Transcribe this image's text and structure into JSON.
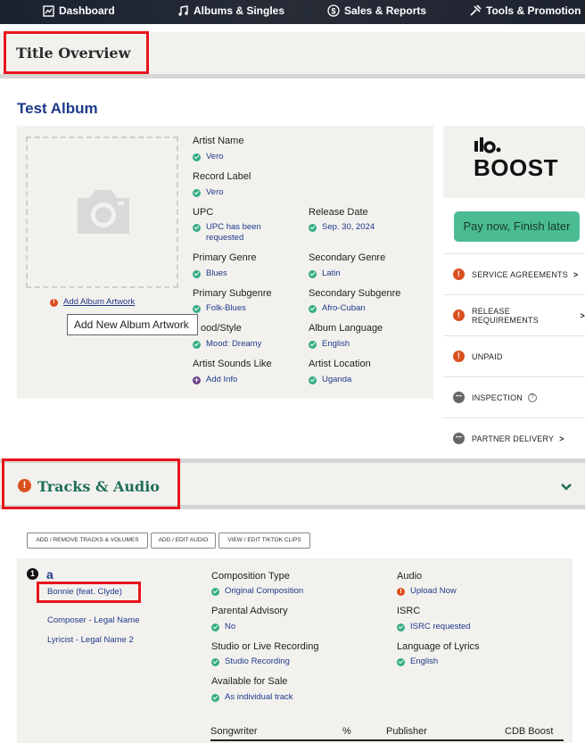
{
  "nav": {
    "items": [
      {
        "label": "Dashboard",
        "icon": "dashboard-icon"
      },
      {
        "label": "Albums & Singles",
        "icon": "music-note-icon"
      },
      {
        "label": "Sales & Reports",
        "icon": "dollar-icon"
      },
      {
        "label": "Tools & Promotion",
        "icon": "tools-icon"
      }
    ]
  },
  "page": {
    "title": "Title Overview"
  },
  "album": {
    "title": "Test Album",
    "add_artwork": "Add Album Artwork",
    "tooltip": "Add New Album Artwork",
    "fields": {
      "artist_name": {
        "label": "Artist Name",
        "value": "Vero"
      },
      "record_label": {
        "label": "Record Label",
        "value": "Vero"
      },
      "upc": {
        "label": "UPC",
        "value": "UPC has been requested"
      },
      "release_date": {
        "label": "Release Date",
        "value": "Sep. 30, 2024"
      },
      "primary_genre": {
        "label": "Primary Genre",
        "value": "Blues"
      },
      "secondary_genre": {
        "label": "Secondary Genre",
        "value": "Latin"
      },
      "primary_subgenre": {
        "label": "Primary Subgenre",
        "value": "Folk-Blues"
      },
      "secondary_subgenre": {
        "label": "Secondary Subgenre",
        "value": "Afro-Cuban"
      },
      "mood": {
        "label": "Mood/Style",
        "label_visible": "ood/Style",
        "value": "Mood: Dreamy"
      },
      "album_language": {
        "label": "Album Language",
        "value": "English"
      },
      "sounds_like": {
        "label": "Artist Sounds Like",
        "value": "Add Info"
      },
      "artist_location": {
        "label": "Artist Location",
        "value": "Uganda"
      }
    }
  },
  "sidebar": {
    "brand": "BOOST",
    "pay_button": "Pay now, Finish later",
    "items": [
      {
        "label": "SERVICE AGREEMENTS",
        "status": "error",
        "chevron": ">"
      },
      {
        "label": "RELEASE REQUIREMENTS",
        "status": "error",
        "chevron": ">"
      },
      {
        "label": "UNPAID",
        "status": "error"
      },
      {
        "label": "INSPECTION",
        "status": "pending",
        "help": "?"
      },
      {
        "label": "PARTNER DELIVERY",
        "status": "pending",
        "chevron": ">"
      }
    ]
  },
  "tracks": {
    "section_title": "Tracks & Audio",
    "buttons": [
      "ADD / REMOVE TRACKS & VOLUMES",
      "ADD / EDIT AUDIO",
      "VIEW / EDIT TIKTOK CLIPS"
    ],
    "track": {
      "number": "1",
      "title": "a",
      "artist": "Bonnie (feat. Clyde)",
      "composer": "Composer - Legal Name",
      "lyricist": "Lyricist - Legal Name 2",
      "fields": {
        "composition_type": {
          "label": "Composition Type",
          "value": "Original Composition"
        },
        "audio": {
          "label": "Audio",
          "value": "Upload Now"
        },
        "parental_advisory": {
          "label": "Parental Advisory",
          "value": "No"
        },
        "isrc": {
          "label": "ISRC",
          "value": "ISRC requested"
        },
        "recording": {
          "label": "Studio or Live Recording",
          "value": "Studio Recording"
        },
        "lyrics_language": {
          "label": "Language of Lyrics",
          "value": "English"
        },
        "available_for_sale": {
          "label": "Available for Sale",
          "value": "As individual track"
        }
      },
      "table_headers": [
        "Songwriter",
        "%",
        "Publisher",
        "CDB Boost"
      ]
    }
  },
  "colors": {
    "accent_blue": "#1e3a8a",
    "success_green": "#36ad84",
    "error_orange": "#d9501f",
    "highlight_red": "#e8141d",
    "teal_title": "#1f6e59"
  }
}
